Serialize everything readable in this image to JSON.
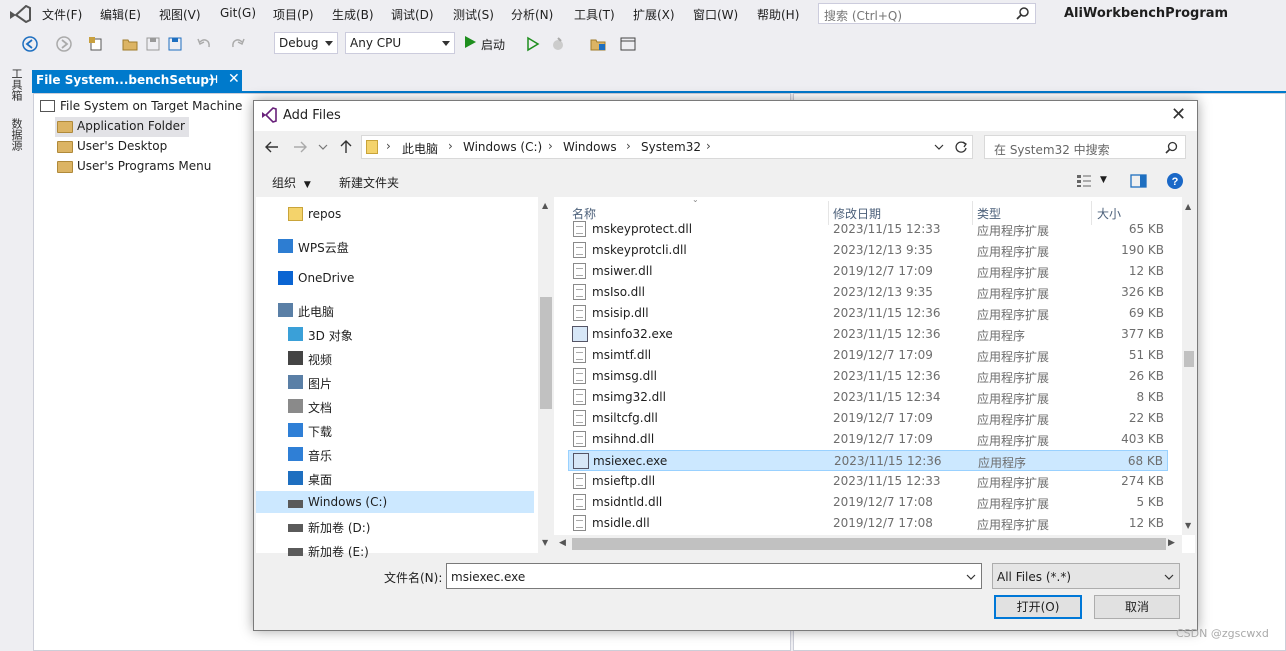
{
  "app": {
    "title": "AliWorkbenchProgram",
    "menu": [
      "文件(F)",
      "编辑(E)",
      "视图(V)",
      "Git(G)",
      "项目(P)",
      "生成(B)",
      "调试(D)",
      "测试(S)",
      "分析(N)",
      "工具(T)",
      "扩展(X)",
      "窗口(W)",
      "帮助(H)"
    ],
    "search_placeholder": "搜索 (Ctrl+Q)",
    "toolbar": {
      "config": "Debug",
      "platform": "Any CPU",
      "start_label": "启动"
    },
    "side_tabs": [
      "工具箱",
      "数据源"
    ],
    "doc_tab": {
      "title": "File System...benchSetup)",
      "pin": "⊣",
      "close": "✕"
    },
    "fs_tree": {
      "root": "File System on Target Machine",
      "items": [
        "Application Folder",
        "User's Desktop",
        "User's Programs Menu"
      ]
    },
    "watermark": "CSDN @zgscwxd"
  },
  "dialog": {
    "title": "Add Files",
    "breadcrumb": [
      "此电脑",
      "Windows (C:)",
      "Windows",
      "System32"
    ],
    "search_placeholder": "在 System32 中搜索",
    "cmd": {
      "organize": "组织",
      "new_folder": "新建文件夹"
    },
    "nav": [
      {
        "label": "repos",
        "icon": "folder-icon"
      },
      {
        "label": "WPS云盘",
        "icon": "cloud-icon"
      },
      {
        "label": "OneDrive",
        "icon": "onedrive-icon"
      },
      {
        "label": "此电脑",
        "icon": "computer-icon"
      },
      {
        "label": "3D 对象",
        "icon": "3d-objects-icon"
      },
      {
        "label": "视频",
        "icon": "video-icon"
      },
      {
        "label": "图片",
        "icon": "pictures-icon"
      },
      {
        "label": "文档",
        "icon": "documents-icon"
      },
      {
        "label": "下载",
        "icon": "download-icon"
      },
      {
        "label": "音乐",
        "icon": "music-icon"
      },
      {
        "label": "桌面",
        "icon": "desktop-icon"
      },
      {
        "label": "Windows (C:)",
        "icon": "drive-icon"
      },
      {
        "label": "新加卷 (D:)",
        "icon": "drive-icon"
      },
      {
        "label": "新加卷 (E:)",
        "icon": "drive-icon"
      }
    ],
    "columns": [
      "名称",
      "修改日期",
      "类型",
      "大小"
    ],
    "files": [
      {
        "name": "mskeyprotect.dll",
        "date": "2023/11/15 12:33",
        "type": "应用程序扩展",
        "size": "65 KB"
      },
      {
        "name": "mskeyprotcli.dll",
        "date": "2023/12/13 9:35",
        "type": "应用程序扩展",
        "size": "190 KB"
      },
      {
        "name": "msiwer.dll",
        "date": "2019/12/7 17:09",
        "type": "应用程序扩展",
        "size": "12 KB"
      },
      {
        "name": "msIso.dll",
        "date": "2023/12/13 9:35",
        "type": "应用程序扩展",
        "size": "326 KB"
      },
      {
        "name": "msisip.dll",
        "date": "2023/11/15 12:36",
        "type": "应用程序扩展",
        "size": "69 KB"
      },
      {
        "name": "msinfo32.exe",
        "date": "2023/11/15 12:36",
        "type": "应用程序",
        "size": "377 KB"
      },
      {
        "name": "msimtf.dll",
        "date": "2019/12/7 17:09",
        "type": "应用程序扩展",
        "size": "51 KB"
      },
      {
        "name": "msimsg.dll",
        "date": "2023/11/15 12:36",
        "type": "应用程序扩展",
        "size": "26 KB"
      },
      {
        "name": "msimg32.dll",
        "date": "2023/11/15 12:34",
        "type": "应用程序扩展",
        "size": "8 KB"
      },
      {
        "name": "msiltcfg.dll",
        "date": "2019/12/7 17:09",
        "type": "应用程序扩展",
        "size": "22 KB"
      },
      {
        "name": "msihnd.dll",
        "date": "2019/12/7 17:09",
        "type": "应用程序扩展",
        "size": "403 KB"
      },
      {
        "name": "msiexec.exe",
        "date": "2023/11/15 12:36",
        "type": "应用程序",
        "size": "68 KB"
      },
      {
        "name": "msieftp.dll",
        "date": "2023/11/15 12:33",
        "type": "应用程序扩展",
        "size": "274 KB"
      },
      {
        "name": "msidntld.dll",
        "date": "2019/12/7 17:08",
        "type": "应用程序扩展",
        "size": "5 KB"
      },
      {
        "name": "msidle.dll",
        "date": "2019/12/7 17:08",
        "type": "应用程序扩展",
        "size": "12 KB"
      }
    ],
    "selected_file": "msiexec.exe",
    "filename_label": "文件名(N):",
    "filename_value": "msiexec.exe",
    "filter": "All Files (*.*)",
    "open_label": "打开(O)",
    "cancel_label": "取消",
    "accent": "#0078d7",
    "selection_bg": "#cce8ff"
  }
}
